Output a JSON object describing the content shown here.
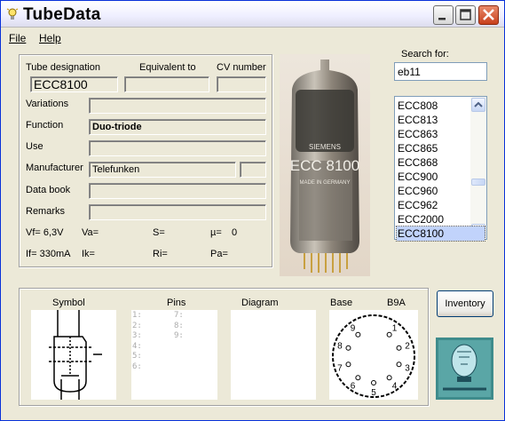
{
  "window": {
    "title": "TubeData"
  },
  "menu": {
    "file": "File",
    "help": "Help"
  },
  "info": {
    "tube_designation_label": "Tube designation",
    "equivalent_label": "Equivalent to",
    "cv_label": "CV number",
    "tube_designation": "ECC8100",
    "equivalent": "",
    "cv": "",
    "variations_label": "Variations",
    "variations": "",
    "function_label": "Function",
    "function": "Duo-triode",
    "use_label": "Use",
    "use": "",
    "manufacturer_label": "Manufacturer",
    "manufacturer": "Telefunken",
    "manufacturer_code": "",
    "databook_label": "Data book",
    "databook": "",
    "remarks_label": "Remarks",
    "remarks": ""
  },
  "params": {
    "vf": "Vf= 6,3V",
    "va": "Va=",
    "s": "S=",
    "mu": "µ=",
    "mu_val": "0",
    "if": "If= 330mA",
    "ik": "Ik=",
    "ri": "Ri=",
    "pa": "Pa="
  },
  "search": {
    "label": "Search for:",
    "value": "eb11",
    "results": [
      "ECC808",
      "ECC813",
      "ECC863",
      "ECC865",
      "ECC868",
      "ECC900",
      "ECC960",
      "ECC962",
      "ECC2000",
      "ECC8100"
    ],
    "selected": "ECC8100"
  },
  "bottom": {
    "symbol_label": "Symbol",
    "pins_label": "Pins",
    "diagram_label": "Diagram",
    "base_label": "Base",
    "base_type": "B9A",
    "pins_left": [
      "1:",
      "2:",
      "3:",
      "4:",
      "5:",
      "6:"
    ],
    "pins_right": [
      "7:",
      "8:",
      "9:"
    ]
  },
  "photo": {
    "brand": "SIEMENS",
    "marking": "ECC 8100",
    "origin": "MADE IN GERMANY"
  },
  "buttons": {
    "inventory": "Inventory"
  },
  "base_pins": [
    "1",
    "2",
    "3",
    "4",
    "5",
    "6",
    "7",
    "8",
    "9"
  ]
}
